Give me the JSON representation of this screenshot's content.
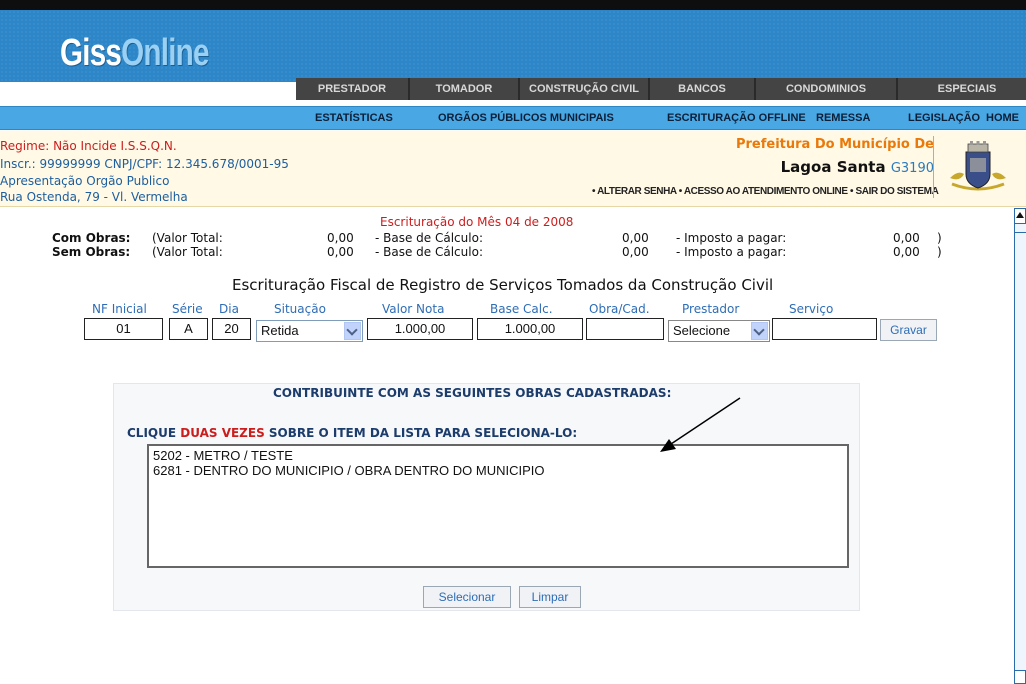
{
  "brand": {
    "logo_part1": "Giss",
    "logo_part2": "Online"
  },
  "nav_primary": [
    "PRESTADOR",
    "TOMADOR",
    "CONSTRUÇÃO CIVIL",
    "BANCOS",
    "CONDOMINIOS",
    "ESPECIAIS"
  ],
  "nav_secondary": [
    "ESTATÍSTICAS",
    "ORGÃOS PÚBLICOS MUNICIPAIS",
    "ESCRITURAÇÃO OFFLINE",
    "REMESSA",
    "LEGISLAÇÃO",
    "HOME"
  ],
  "taxpayer": {
    "regime": "Regime: Não Incide I.S.S.Q.N.",
    "inscr": "Inscr.: 99999999   CNPJ/CPF: 12.345.678/0001-95",
    "type": "Apresentação Orgão Publico",
    "address": "Rua Ostenda, 79 - Vl. Vermelha"
  },
  "prefeitura": {
    "title": "Prefeitura Do Município De",
    "city": "Lagoa Santa",
    "code": "G3190",
    "links": "• ALTERAR SENHA  • ACESSO AO ATENDIMENTO ONLINE  • SAIR DO SISTEMA"
  },
  "summary": {
    "title": "Escrituração do Mês 04 de 2008",
    "rows": [
      {
        "label": "Com Obras:",
        "total_label": "(Valor Total:",
        "total": "0,00",
        "base_label": "- Base de Cálculo:",
        "base": "0,00",
        "imposto_label": "- Imposto a pagar:",
        "imposto": "0,00",
        "close": ")"
      },
      {
        "label": "Sem Obras:",
        "total_label": "(Valor Total:",
        "total": "0,00",
        "base_label": "- Base de Cálculo:",
        "base": "0,00",
        "imposto_label": "- Imposto a pagar:",
        "imposto": "0,00",
        "close": ")"
      }
    ]
  },
  "form": {
    "title": "Escrituração Fiscal de Registro de Serviços Tomados da Construção Civil",
    "columns": [
      "NF Inicial",
      "Série",
      "Dia",
      "Situação",
      "Valor Nota",
      "Base Calc.",
      "Obra/Cad.",
      "Prestador",
      "Serviço"
    ],
    "values": {
      "nf_inicial": "01",
      "serie": "A",
      "dia": "20",
      "situacao": "Retida",
      "valor_nota": "1.000,00",
      "base_calc": "1.000,00",
      "obra_cad": "",
      "prestador": "Selecione",
      "servico": ""
    },
    "save_label": "Gravar"
  },
  "obras_panel": {
    "title": "CONTRIBUINTE COM AS SEGUINTES OBRAS CADASTRADAS:",
    "instruction_part1": "CLIQUE ",
    "instruction_highlight": "DUAS VEZES",
    "instruction_part2": " SOBRE O ITEM DA LISTA PARA SELECIONA-LO:",
    "items": [
      "5202 - METRO / TESTE",
      "6281 - DENTRO DO MUNICIPIO / OBRA DENTRO DO MUNICIPIO"
    ],
    "select_label": "Selecionar",
    "clear_label": "Limpar"
  }
}
